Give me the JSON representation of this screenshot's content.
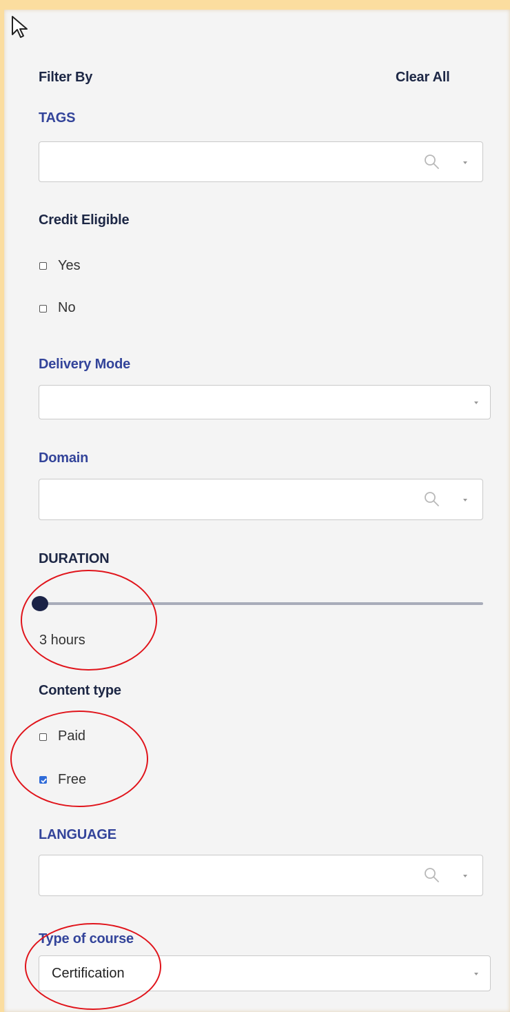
{
  "header": {
    "title": "Filter By",
    "clear_label": "Clear All"
  },
  "tags": {
    "label": "TAGS",
    "value": ""
  },
  "credit": {
    "label": "Credit Eligible",
    "options": [
      {
        "label": "Yes",
        "checked": false
      },
      {
        "label": "No",
        "checked": false
      }
    ]
  },
  "delivery": {
    "label": "Delivery Mode",
    "value": ""
  },
  "domain": {
    "label": "Domain",
    "value": ""
  },
  "duration": {
    "label": "DURATION",
    "value_text": "3 hours",
    "fraction": 0.0
  },
  "content": {
    "label": "Content type",
    "options": [
      {
        "label": "Paid",
        "checked": false
      },
      {
        "label": "Free",
        "checked": true
      }
    ]
  },
  "language": {
    "label": "LANGUAGE",
    "value": ""
  },
  "course_type": {
    "label": "Type of course",
    "value": "Certification"
  },
  "colors": {
    "accent": "#33449a",
    "dark": "#1d2745",
    "check": "#2f6bd8",
    "annotation": "#e0141b",
    "background": "#fbdd9f"
  },
  "icons": {
    "cursor": "pointer-cursor-icon",
    "search": "search-icon",
    "dropdown": "caret-down-icon"
  }
}
